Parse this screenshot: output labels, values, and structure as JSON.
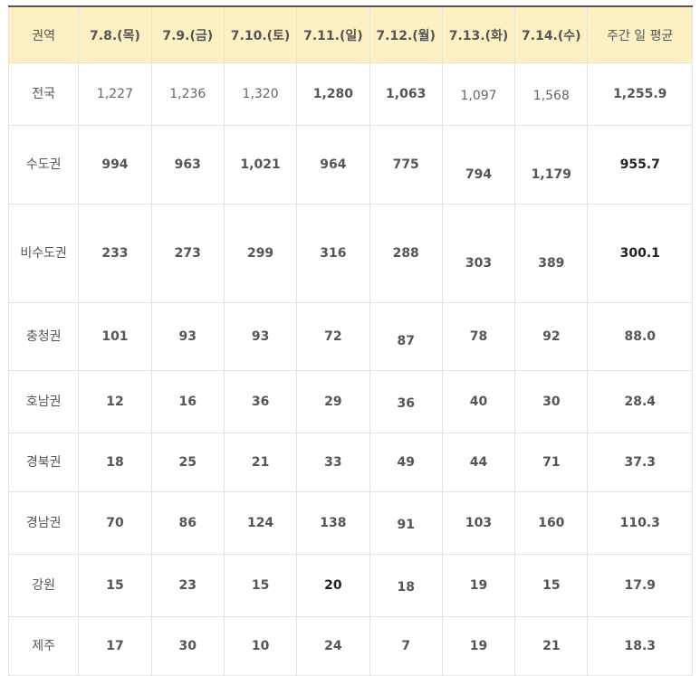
{
  "table": {
    "headers": [
      "권역",
      "7.8.(목)",
      "7.9.(금)",
      "7.10.(토)",
      "7.11.(일)",
      "7.12.(월)",
      "7.13.(화)",
      "7.14.(수)",
      "주간 일 평균"
    ],
    "rows": [
      {
        "region": "전국",
        "values": [
          "1,227",
          "1,236",
          "1,320",
          "1,280",
          "1,063",
          "1,097",
          "1,568"
        ],
        "avg": "1,255.9"
      },
      {
        "region": "수도권",
        "values": [
          "994",
          "963",
          "1,021",
          "964",
          "775",
          "794",
          "1,179"
        ],
        "avg": "955.7"
      },
      {
        "region": "비수도권",
        "values": [
          "233",
          "273",
          "299",
          "316",
          "288",
          "303",
          "389"
        ],
        "avg": "300.1"
      },
      {
        "region": "충청권",
        "values": [
          "101",
          "93",
          "93",
          "72",
          "87",
          "78",
          "92"
        ],
        "avg": "88.0"
      },
      {
        "region": "호남권",
        "values": [
          "12",
          "16",
          "36",
          "29",
          "36",
          "40",
          "30"
        ],
        "avg": "28.4"
      },
      {
        "region": "경북권",
        "values": [
          "18",
          "25",
          "21",
          "33",
          "49",
          "44",
          "71"
        ],
        "avg": "37.3"
      },
      {
        "region": "경남권",
        "values": [
          "70",
          "86",
          "124",
          "138",
          "91",
          "103",
          "160"
        ],
        "avg": "110.3"
      },
      {
        "region": "강원",
        "values": [
          "15",
          "23",
          "15",
          "20",
          "18",
          "19",
          "15"
        ],
        "avg": "17.9"
      },
      {
        "region": "제주",
        "values": [
          "17",
          "30",
          "10",
          "24",
          "7",
          "19",
          "21"
        ],
        "avg": "18.3"
      }
    ]
  }
}
